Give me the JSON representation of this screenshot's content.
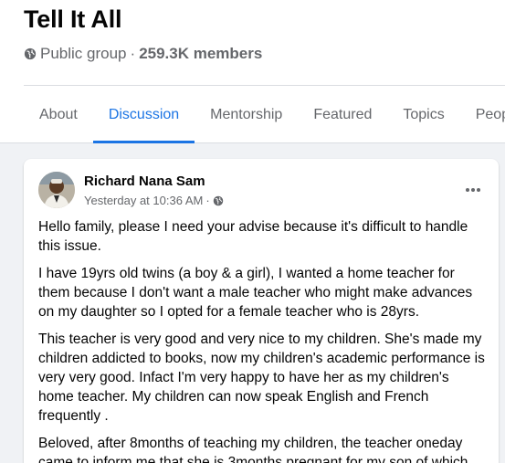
{
  "group": {
    "title": "Tell It All",
    "privacy": "Public group",
    "separator": "·",
    "members": "259.3K members"
  },
  "tabs": [
    {
      "label": "About",
      "active": false
    },
    {
      "label": "Discussion",
      "active": true
    },
    {
      "label": "Mentorship",
      "active": false
    },
    {
      "label": "Featured",
      "active": false
    },
    {
      "label": "Topics",
      "active": false
    },
    {
      "label": "Peopl",
      "active": false
    }
  ],
  "post": {
    "author": "Richard Nana Sam",
    "timestamp": "Yesterday at 10:36 AM",
    "dot": "·",
    "more_icon": "more-horizontal-icon",
    "paragraphs": [
      "Hello family, please I need your advise because it's difficult to handle this issue.",
      "I have 19yrs old twins (a boy & a girl), I wanted a home teacher for them because I don't want a male teacher who might make advances on my daughter so I opted for a female teacher who is 28yrs.",
      "This teacher is very good and very nice to my children. She's made my children addicted to books, now my children's academic performance is very very good. Infact I'm very happy to have her as my children's home teacher. My children can now speak English and French frequently .",
      "Beloved, after 8months of teaching my children, the teacher oneday came to inform me that she is 3months pregnant for my son of which"
    ]
  },
  "colors": {
    "accent": "#1b74e4",
    "secondary_text": "#65676b",
    "background": "#f0f2f5"
  }
}
